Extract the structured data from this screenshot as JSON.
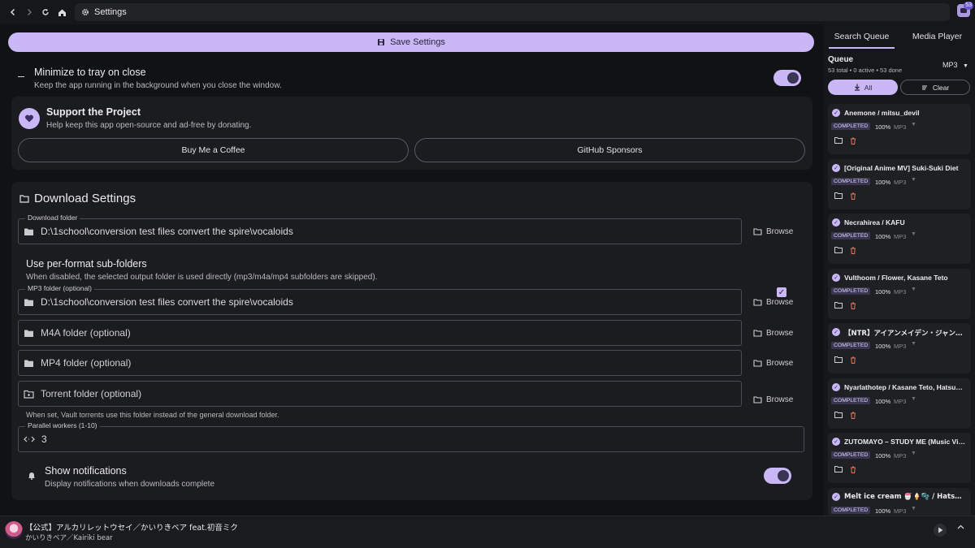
{
  "window": {
    "address_title": "Settings"
  },
  "toolbar": {
    "save_label": "Save Settings"
  },
  "top": {
    "badge": "53"
  },
  "minimize": {
    "title": "Minimize to tray on close",
    "desc": "Keep the app running in the background when you close the window."
  },
  "support": {
    "title": "Support the Project",
    "desc": "Help keep this app open-source and ad-free by donating.",
    "coffee": "Buy Me a Coffee",
    "github": "GitHub Sponsors"
  },
  "download": {
    "title": "Download Settings",
    "folder_label": "Download folder",
    "folder_value": "D:\\1school\\conversion test files convert the spire\\vocaloids",
    "browse": "Browse",
    "subfolders_title": "Use per-format sub-folders",
    "subfolders_desc": "When disabled, the selected output folder is used directly (mp3/m4a/mp4 subfolders are skipped).",
    "mp3_label": "MP3 folder (optional)",
    "mp3_value": "D:\\1school\\conversion test files convert the spire\\vocaloids",
    "m4a_placeholder": "M4A folder (optional)",
    "mp4_placeholder": "MP4 folder (optional)",
    "torrent_placeholder": "Torrent folder (optional)",
    "torrent_note": "When set, Vault torrents use this folder instead of the general download folder.",
    "workers_label": "Parallel workers (1-10)",
    "workers_value": "3",
    "notify_title": "Show notifications",
    "notify_desc": "Display notifications when downloads complete"
  },
  "panel": {
    "tab_search": "Search Queue",
    "tab_media": "Media Player",
    "queue_title": "Queue",
    "queue_sub": "53 total • 0 active • 53 done",
    "format": "MP3",
    "btn_all": "All",
    "btn_clear": "Clear",
    "items": [
      {
        "name": "Anemone / mitsu_devil",
        "status": "COMPLETED",
        "pct": "100%",
        "fmt": "MP3"
      },
      {
        "name": "[Original Anime MV] Suki-Suki Diet",
        "status": "COMPLETED",
        "pct": "100%",
        "fmt": "MP3"
      },
      {
        "name": "Necrahirea / KAFU",
        "status": "COMPLETED",
        "pct": "100%",
        "fmt": "MP3"
      },
      {
        "name": "Vulthoom / Flower, Kasane Teto",
        "status": "COMPLETED",
        "pct": "100%",
        "fmt": "MP3"
      },
      {
        "name": "【NTR】アイアンメイデン・ジャンク(Iron Maiden Junk)",
        "status": "COMPLETED",
        "pct": "100%",
        "fmt": "MP3"
      },
      {
        "name": "Nyarlathotep / Kasane Teto, Hatsune Miku",
        "status": "COMPLETED",
        "pct": "100%",
        "fmt": "MP3"
      },
      {
        "name": "ZUTOMAYO – STUDY ME (Music Video)",
        "status": "COMPLETED",
        "pct": "100%",
        "fmt": "MP3"
      },
      {
        "name": "Melt ice cream 🍧🍦🫧 / Hatsune Miku",
        "status": "COMPLETED",
        "pct": "100%",
        "fmt": "MP3"
      }
    ]
  },
  "player": {
    "title": "【公式】アルカリレットウセイ／かいりきベア feat.初音ミク",
    "artist": "かいりきベア／Kairiki bear"
  }
}
